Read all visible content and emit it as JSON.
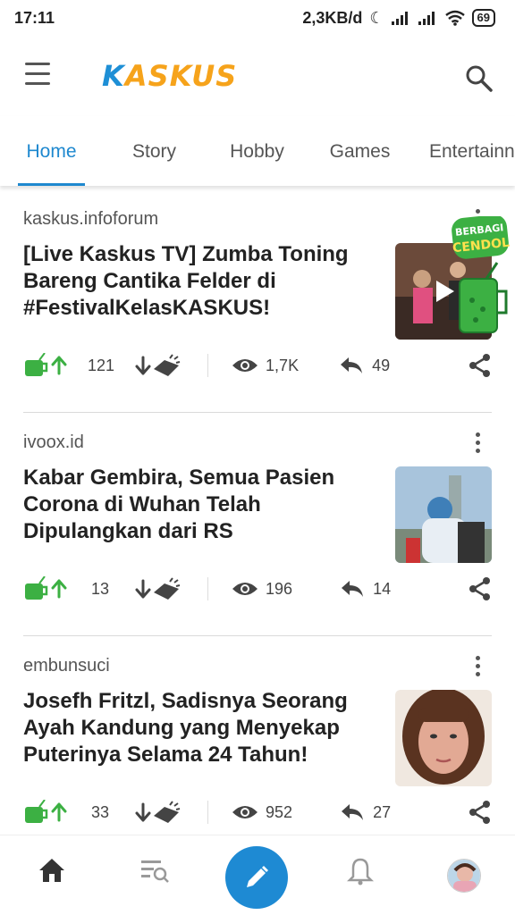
{
  "status": {
    "time": "17:11",
    "speed": "2,3KB/d",
    "battery": "69"
  },
  "app": {
    "logo_k": "K",
    "logo_rest": "ASKUS"
  },
  "tabs": [
    {
      "label": "Home",
      "active": true
    },
    {
      "label": "Story"
    },
    {
      "label": "Hobby"
    },
    {
      "label": "Games"
    },
    {
      "label": "Entertainn"
    }
  ],
  "cendol_badge": {
    "line1": "BERBAGI",
    "line2": "CENDOL"
  },
  "posts": [
    {
      "source": "kaskus.infoforum",
      "title": "[Live Kaskus TV] Zumba Toning Bareng Cantika Felder di #FestivalKelasKASKUS!",
      "upvotes": "121",
      "views": "1,7K",
      "replies": "49"
    },
    {
      "source": "ivoox.id",
      "title": "Kabar Gembira, Semua Pasien Corona di Wuhan Telah Dipulangkan dari RS",
      "upvotes": "13",
      "views": "196",
      "replies": "14"
    },
    {
      "source": "embunsuci",
      "title": "Josefh Fritzl, Sadisnya Seorang Ayah Kandung yang Menyekap Puterinya Selama 24 Tahun!",
      "upvotes": "33",
      "views": "952",
      "replies": "27"
    }
  ],
  "colors": {
    "accent": "#1e88cf",
    "logo_orange": "#f6a31b",
    "cendol_green": "#3cb043"
  }
}
